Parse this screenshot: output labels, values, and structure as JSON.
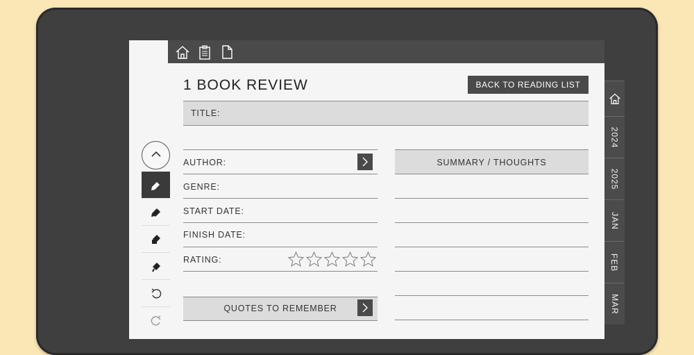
{
  "page": {
    "title": "1 BOOK REVIEW",
    "back_button": "BACK TO READING LIST"
  },
  "topbar": {
    "icons": [
      "home-icon",
      "clipboard-icon",
      "page-icon"
    ]
  },
  "side_tabs": [
    "2024",
    "2025",
    "JAN",
    "FEB",
    "MAR"
  ],
  "fields": {
    "title": "TITLE:",
    "author": "AUTHOR:",
    "genre": "GENRE:",
    "start_date": "START DATE:",
    "finish_date": "FINISH DATE:",
    "rating": "RATING:"
  },
  "rating": {
    "filled": 0,
    "max": 5
  },
  "sections": {
    "summary": "SUMMARY / THOUGHTS",
    "quotes": "QUOTES TO REMEMBER"
  },
  "toolbar": {
    "tools": [
      "pen-icon",
      "marker-icon",
      "highlighter-icon",
      "eraser-icon",
      "undo-icon",
      "redo-icon"
    ]
  }
}
